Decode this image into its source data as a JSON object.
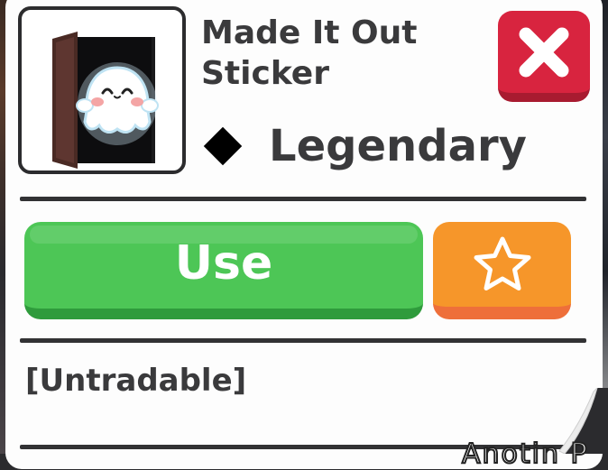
{
  "item": {
    "name": "Made It Out Sticker",
    "rarity": "Legendary",
    "tradability": "[Untradable]",
    "image_icon": "ghost-in-doorway-icon"
  },
  "actions": {
    "use_label": "Use",
    "favorite_icon": "star-outline-icon",
    "close_icon": "close-x-icon"
  },
  "background": {
    "partial_text": "Anotin P"
  },
  "colors": {
    "use_green": "#4dc656",
    "favorite_orange": "#f6962a",
    "close_red": "#d8243f",
    "text_dark": "#3a3a3c",
    "rarity_diamond": "#000000"
  }
}
